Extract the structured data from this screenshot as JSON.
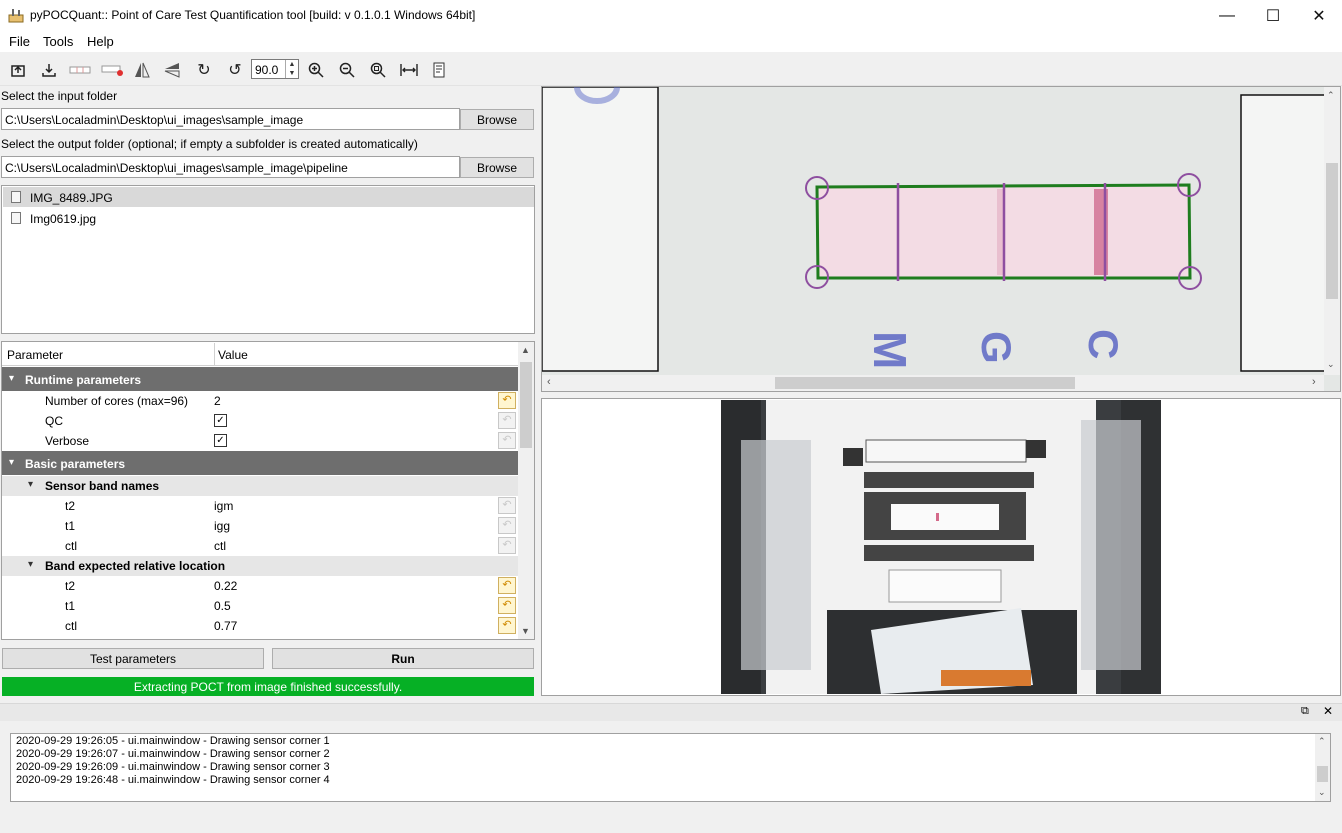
{
  "window": {
    "title": "pyPOCQuant:: Point of Care Test Quantification tool [build: v 0.1.0.1 Windows 64bit]",
    "controls": {
      "minimize": "—",
      "maximize": "☐",
      "close": "✕"
    }
  },
  "menu": [
    "File",
    "Tools",
    "Help"
  ],
  "toolbar": {
    "icons": [
      "open-folder-icon",
      "download-icon",
      "sensor-outline-icon",
      "remove-sensor-icon",
      "mirror-vertical-icon",
      "mirror-horizontal-icon",
      "rotate-cw-icon",
      "rotate-ccw-icon",
      "zoom-in-icon",
      "zoom-out-icon",
      "zoom-reset-icon",
      "fit-width-icon",
      "log-icon"
    ],
    "rotation_value": "90.0"
  },
  "input": {
    "label": "Select the input folder",
    "value": "C:\\Users\\Localadmin\\Desktop\\ui_images\\sample_image",
    "browse": "Browse"
  },
  "output": {
    "label": "Select the output folder (optional; if empty a subfolder is created automatically)",
    "value": "C:\\Users\\Localadmin\\Desktop\\ui_images\\sample_image\\pipeline",
    "browse": "Browse"
  },
  "files": [
    "IMG_8489.JPG",
    "Img0619.jpg"
  ],
  "params": {
    "header": {
      "name": "Parameter",
      "value": "Value"
    },
    "runtime": {
      "title": "Runtime parameters",
      "cores_label": "Number of cores (max=96)",
      "cores_value": "2",
      "qc_label": "QC",
      "verbose_label": "Verbose",
      "qc_checked": true,
      "verbose_checked": true
    },
    "basic": {
      "title": "Basic parameters",
      "band_names": {
        "title": "Sensor band names",
        "rows": [
          {
            "name": "t2",
            "value": "igm"
          },
          {
            "name": "t1",
            "value": "igg"
          },
          {
            "name": "ctl",
            "value": "ctl"
          }
        ]
      },
      "band_location": {
        "title": "Band expected relative location",
        "rows": [
          {
            "name": "t2",
            "value": "0.22"
          },
          {
            "name": "t1",
            "value": "0.5"
          },
          {
            "name": "ctl",
            "value": "0.77"
          }
        ]
      }
    }
  },
  "buttons": {
    "test": "Test parameters",
    "run": "Run"
  },
  "status": "Extracting POCT from image finished successfully.",
  "sensor_letters": [
    "M",
    "G",
    "C"
  ],
  "log": [
    "2020-09-29 19:26:05 - ui.mainwindow - Drawing sensor corner 1",
    "2020-09-29 19:26:07 - ui.mainwindow - Drawing sensor corner 2",
    "2020-09-29 19:26:09 - ui.mainwindow - Drawing sensor corner 3",
    "2020-09-29 19:26:48 - ui.mainwindow - Drawing sensor corner 4"
  ],
  "colors": {
    "status_green": "#06b025",
    "sensor_box": "#1e7d1e",
    "band_lines": "#8e4fa0",
    "category_bg": "#6e6e6e"
  }
}
